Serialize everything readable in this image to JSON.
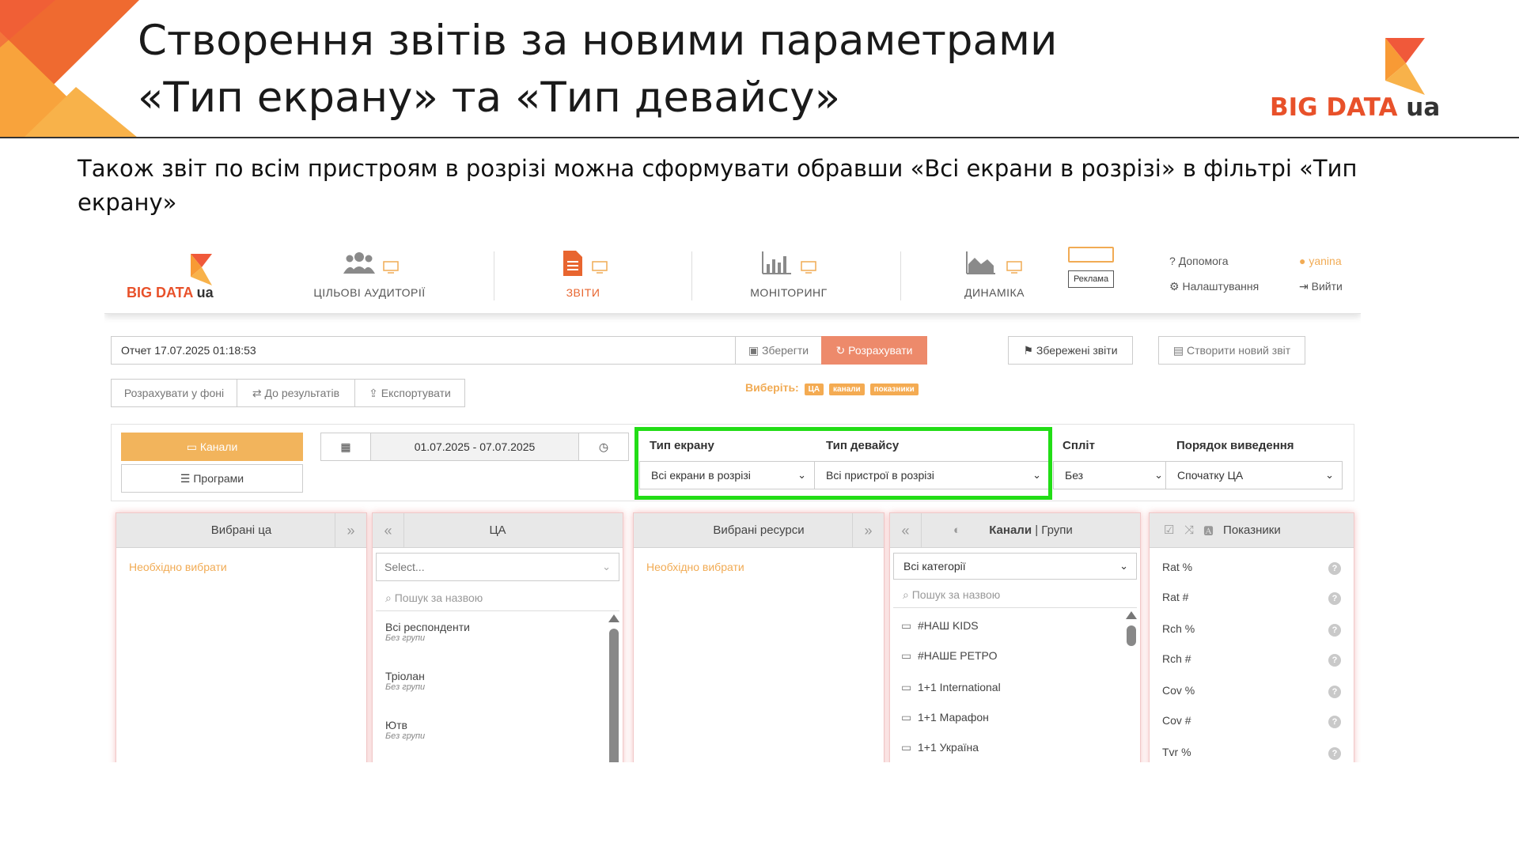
{
  "slide": {
    "title_line1": "Створення звітів за новими параметрами",
    "title_line2": "«Тип екрану» та «Тип девайсу»",
    "logo_text": "BIG DATA",
    "logo_suffix": "ua",
    "subtitle": "Також звіт по всім пристроям в розрізі можна сформувати обравши «Всі екрани в розрізі» в фільтрі «Тип екрану»"
  },
  "colors": {
    "accent_orange": "#f1ab54",
    "brand_red": "#e8512a",
    "highlight_green": "#22dd16"
  },
  "app": {
    "logo_text": "BIG DATA",
    "logo_suffix": "ua",
    "nav": {
      "audiences": "ЦІЛЬОВІ АУДИТОРІЇ",
      "reports": "ЗВІТИ",
      "monitoring": "МОНІТОРИНГ",
      "dynamics": "ДИНАМІКА",
      "ads": "Реклама"
    },
    "links": {
      "help": "Допомога",
      "settings": "Налаштування",
      "user": "yanina",
      "logout": "Вийти"
    },
    "toolbar": {
      "report_name": "Отчет 17.07.2025 01:18:53",
      "save": "Зберегти",
      "calculate": "Розрахувати",
      "saved_reports": "Збережені звіти",
      "new_report": "Створити новий звіт",
      "calc_background": "Розрахувати у фоні",
      "to_results": "До результатів",
      "export": "Експортувати",
      "choose": "Виберіть:",
      "chip_ca": "ЦА",
      "chip_channels": "канали",
      "chip_indicators": "показники"
    },
    "filters": {
      "channels": "Канали",
      "programs": "Програми",
      "date_range": "01.07.2025 - 07.07.2025",
      "screen_type_label": "Тип екрану",
      "screen_type_value": "Всі екрани в розрізі",
      "device_type_label": "Тип девайсу",
      "device_type_value": "Всі пристрої в розрізі",
      "split_label": "Спліт",
      "split_value": "Без",
      "order_label": "Порядок виведення",
      "order_value": "Спочатку ЦА"
    },
    "panels": {
      "selected_ca": {
        "title": "Вибрані ца",
        "placeholder": "Необхідно вибрати"
      },
      "ca": {
        "title": "ЦА",
        "select_placeholder": "Select...",
        "search_placeholder": "Пошук за назвою",
        "items": [
          {
            "name": "Всі респонденти",
            "group": "Без групи"
          },
          {
            "name": "Тріолан",
            "group": "Без групи"
          },
          {
            "name": "Ютв",
            "group": "Без групи"
          }
        ]
      },
      "selected_resources": {
        "title": "Вибрані ресурси",
        "placeholder": "Необхідно вибрати"
      },
      "channels": {
        "title_channels": "Канали",
        "title_sep": " | ",
        "title_groups": "Групи",
        "category": "Всі категорії",
        "search_placeholder": "Пошук за назвою",
        "items": [
          "#НАШ KIDS",
          "#НАШЕ РЕТРО",
          "1+1 International",
          "1+1 Марафон",
          "1+1 Україна"
        ]
      },
      "indicators": {
        "title": "Показники",
        "items": [
          "Rat %",
          "Rat #",
          "Rch %",
          "Rch #",
          "Cov %",
          "Cov #",
          "Tvr %"
        ]
      }
    }
  }
}
